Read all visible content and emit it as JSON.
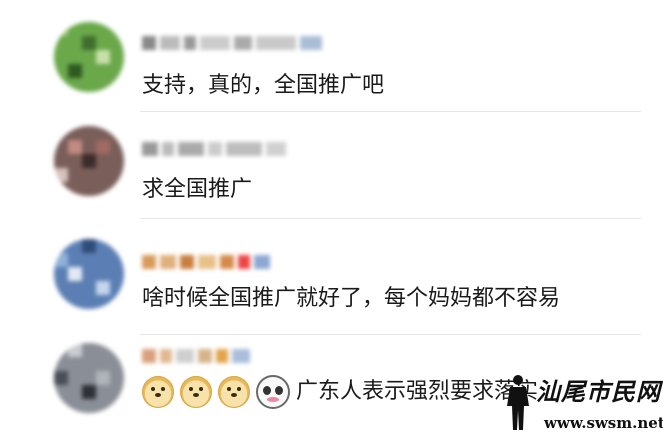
{
  "comments": [
    {
      "text": "支持，真的，全国推广吧",
      "has_emojis": false
    },
    {
      "text": "求全国推广",
      "has_emojis": false
    },
    {
      "text": "啥时候全国推广就好了，每个妈妈都不容易",
      "has_emojis": false
    },
    {
      "text": "广东人表示强烈要求落实",
      "has_emojis": true,
      "emojis": [
        "doge-icon",
        "doge-icon",
        "doge-icon",
        "panda-icon"
      ]
    }
  ],
  "watermark": {
    "brand": "汕尾市民网",
    "url": "www.swsm.net"
  },
  "colors": {
    "background": "#ffffff",
    "text": "#1a1a1a",
    "separator": "#e6e6e6"
  }
}
